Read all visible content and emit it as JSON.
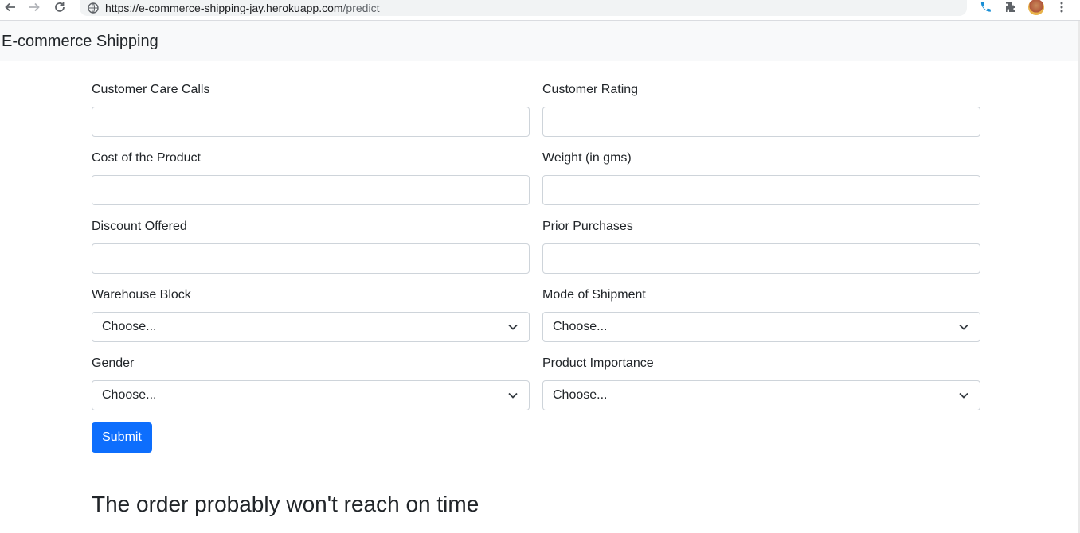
{
  "browser": {
    "url_main": "https://e-commerce-shipping-jay.herokuapp.com",
    "url_path": "/predict"
  },
  "navbar": {
    "brand": "E-commerce Shipping"
  },
  "form": {
    "customer_care_calls": {
      "label": "Customer Care Calls",
      "value": ""
    },
    "customer_rating": {
      "label": "Customer Rating",
      "value": ""
    },
    "cost_of_product": {
      "label": "Cost of the Product",
      "value": ""
    },
    "weight": {
      "label": "Weight (in gms)",
      "value": ""
    },
    "discount_offered": {
      "label": "Discount Offered",
      "value": ""
    },
    "prior_purchases": {
      "label": "Prior Purchases",
      "value": ""
    },
    "warehouse_block": {
      "label": "Warehouse Block",
      "selected": "Choose..."
    },
    "mode_of_shipment": {
      "label": "Mode of Shipment",
      "selected": "Choose..."
    },
    "gender": {
      "label": "Gender",
      "selected": "Choose..."
    },
    "product_importance": {
      "label": "Product Importance",
      "selected": "Choose..."
    },
    "submit_label": "Submit"
  },
  "result": {
    "message": "The order probably won't reach on time"
  },
  "colors": {
    "primary": "#0d6efd",
    "navbar_bg": "#f8f9fa",
    "border": "#ced4da"
  }
}
